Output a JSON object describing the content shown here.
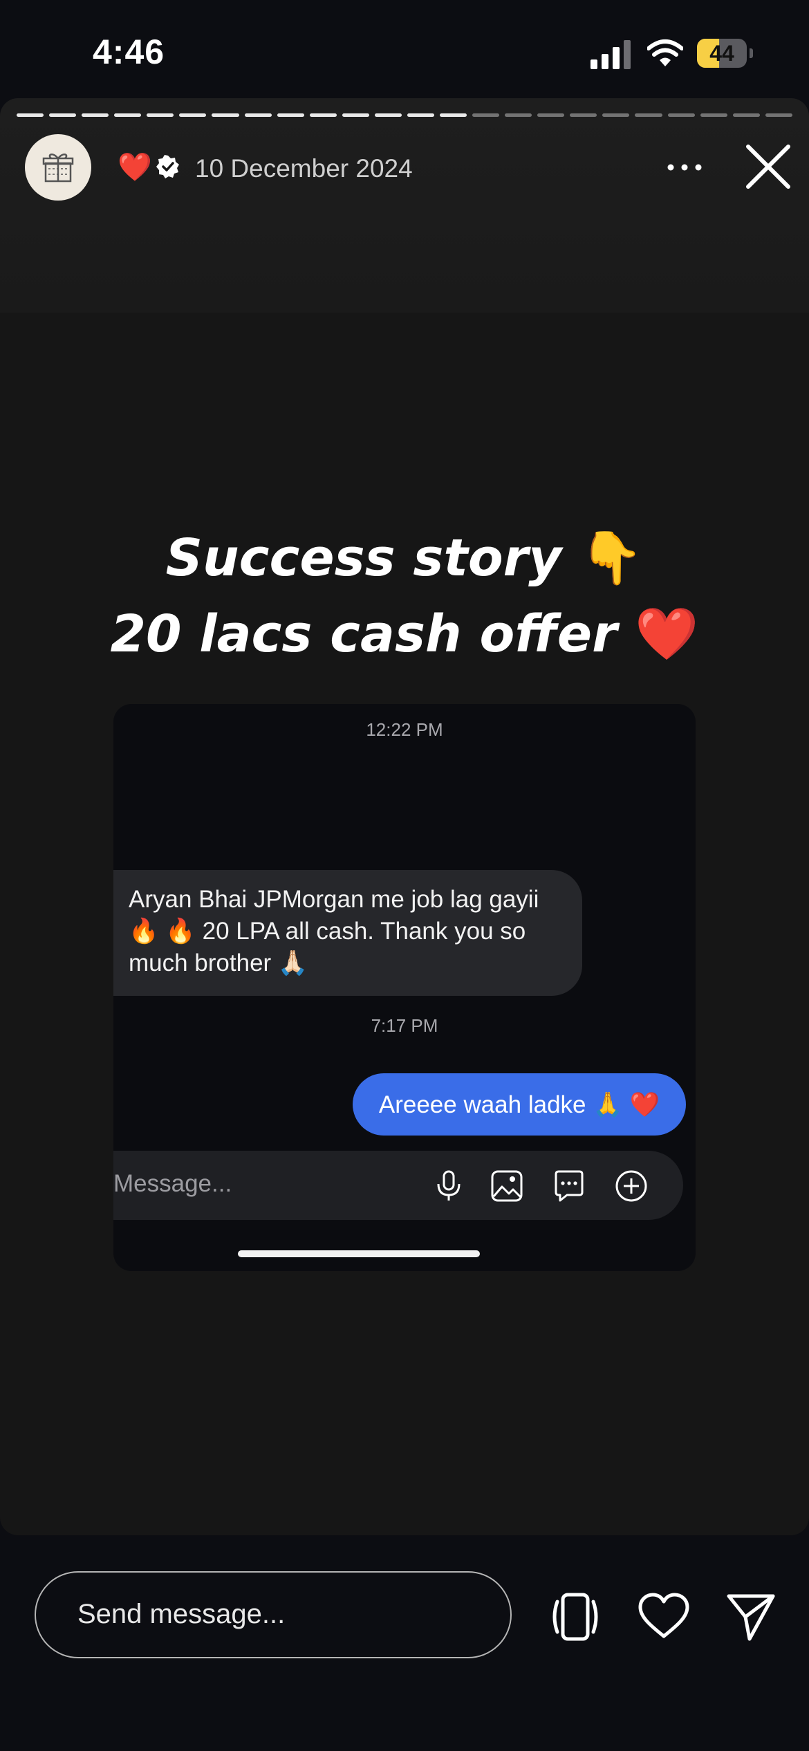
{
  "status_bar": {
    "time": "4:46",
    "battery_level": "44",
    "battery_fraction": 0.44
  },
  "story": {
    "progress": {
      "total_segments": 24,
      "completed_segments": 14
    },
    "avatar_icon": "gift-icon",
    "heart": "❤️",
    "date": "10 December 2024",
    "headline_line1": "Success story",
    "headline_emoji1": "👇",
    "headline_line2": "20 lacs cash offer",
    "headline_emoji2": "❤️"
  },
  "dm": {
    "timestamp_1": "12:22 PM",
    "incoming_message": "Aryan Bhai JPMorgan me job lag gayii 🔥 🔥 20 LPA all cash.  Thank you so much brother 🙏🏻",
    "timestamp_2": "7:17 PM",
    "outgoing_message": "Areeee waah ladke 🙏 ❤️",
    "input_placeholder": "Message...",
    "icons": [
      "microphone-icon",
      "image-icon",
      "chat-icon",
      "plus-circle-icon"
    ]
  },
  "reply_bar": {
    "placeholder": "Send message...",
    "icons": [
      "rotate-icon",
      "heart-outline-icon",
      "send-icon"
    ]
  },
  "colors": {
    "outgoing_bubble": "#3a6de8",
    "battery": "#f7cf45"
  }
}
